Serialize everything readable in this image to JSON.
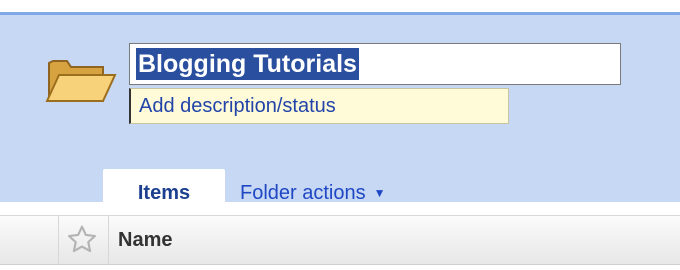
{
  "folder": {
    "icon": "folder-open-icon",
    "title": "Blogging Tutorials",
    "description_placeholder": "Add description/status"
  },
  "tabs": {
    "items_label": "Items",
    "folder_actions_label": "Folder actions",
    "folder_actions_caret": "▼"
  },
  "list_header": {
    "star_icon": "star-icon",
    "name_label": "Name"
  },
  "colors": {
    "header_background": "#c6d8f4",
    "selection": "#2a4f9e",
    "link": "#1f47c4",
    "description_background": "#fffbd8"
  }
}
